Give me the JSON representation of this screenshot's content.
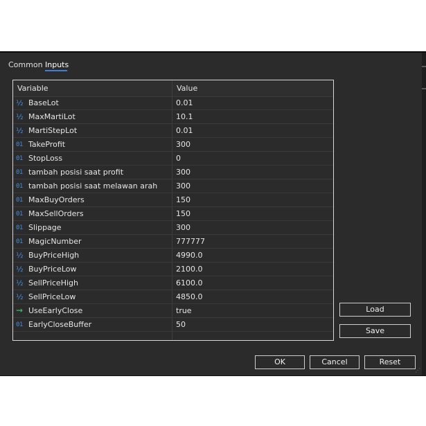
{
  "tabs": [
    {
      "label": "Common"
    },
    {
      "label": "Inputs"
    }
  ],
  "table": {
    "headers": {
      "variable": "Variable",
      "value": "Value"
    },
    "rows": [
      {
        "type": "double",
        "name": "BaseLot",
        "value": "0.01"
      },
      {
        "type": "double",
        "name": "MaxMartiLot",
        "value": "10.1"
      },
      {
        "type": "double",
        "name": "MartiStepLot",
        "value": "0.01"
      },
      {
        "type": "int",
        "name": "TakeProfit",
        "value": "300"
      },
      {
        "type": "int",
        "name": "StopLoss",
        "value": "0"
      },
      {
        "type": "int",
        "name": "tambah posisi saat profit",
        "value": "300"
      },
      {
        "type": "int",
        "name": "tambah posisi saat melawan arah",
        "value": "300"
      },
      {
        "type": "int",
        "name": "MaxBuyOrders",
        "value": "150"
      },
      {
        "type": "int",
        "name": "MaxSellOrders",
        "value": "150"
      },
      {
        "type": "int",
        "name": "Slippage",
        "value": "300"
      },
      {
        "type": "int",
        "name": "MagicNumber",
        "value": "777777"
      },
      {
        "type": "double",
        "name": "BuyPriceHigh",
        "value": "4990.0"
      },
      {
        "type": "double",
        "name": "BuyPriceLow",
        "value": "2100.0"
      },
      {
        "type": "double",
        "name": "SellPriceHigh",
        "value": "6100.0"
      },
      {
        "type": "double",
        "name": "SellPriceLow",
        "value": "4850.0"
      },
      {
        "type": "bool",
        "name": "UseEarlyClose",
        "value": "true"
      },
      {
        "type": "int",
        "name": "EarlyCloseBuffer",
        "value": "50"
      }
    ]
  },
  "icons": {
    "double": "fraction-icon",
    "int": "integer-icon",
    "bool": "boolean-icon"
  },
  "buttons": {
    "load": "Load",
    "save": "Save",
    "ok": "OK",
    "cancel": "Cancel",
    "reset": "Reset"
  },
  "colors": {
    "dialog_bg": "#2b2b2b",
    "accent": "#3d7fd9",
    "bool_icon": "#3bc46a"
  }
}
